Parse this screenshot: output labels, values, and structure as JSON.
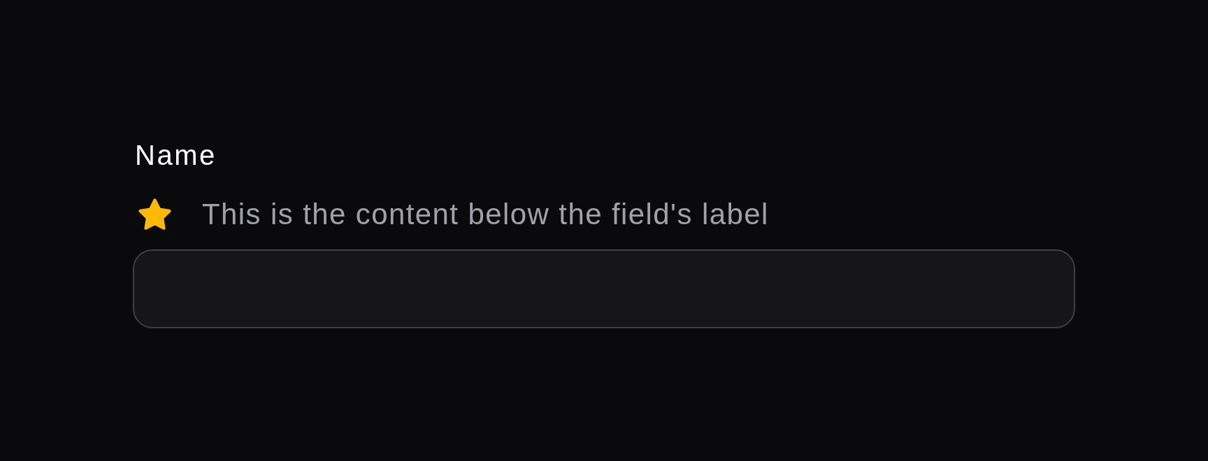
{
  "field": {
    "label": "Name",
    "description": "This is the content below the field's label"
  }
}
